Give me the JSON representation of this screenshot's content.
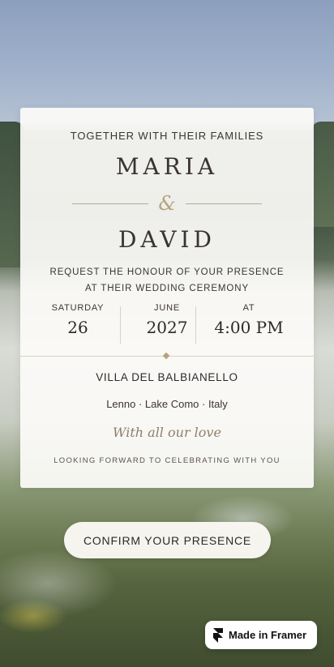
{
  "invitation": {
    "intro": "TOGETHER WITH THEIR FAMILIES",
    "partner1": "MARIA",
    "ampersand": "&",
    "partner2": "DAVID",
    "request_line1": "REQUEST THE HONOUR OF YOUR PRESENCE",
    "request_line2": "AT THEIR WEDDING CEREMONY",
    "date": {
      "day_label": "SATURDAY",
      "day_value": "26",
      "month_label": "JUNE",
      "year_value": "2027",
      "time_label": "AT",
      "time_value": "4:00 PM"
    },
    "venue": "VILLA DEL BALBIANELLO",
    "location": "Lenno · Lake Como · Italy",
    "signoff": "With all our love",
    "closing": "LOOKING FORWARD TO CELEBRATING WITH YOU"
  },
  "actions": {
    "confirm_label": "CONFIRM YOUR PRESENCE"
  },
  "badge": {
    "label": "Made in Framer",
    "icon": "framer-logo-icon"
  }
}
